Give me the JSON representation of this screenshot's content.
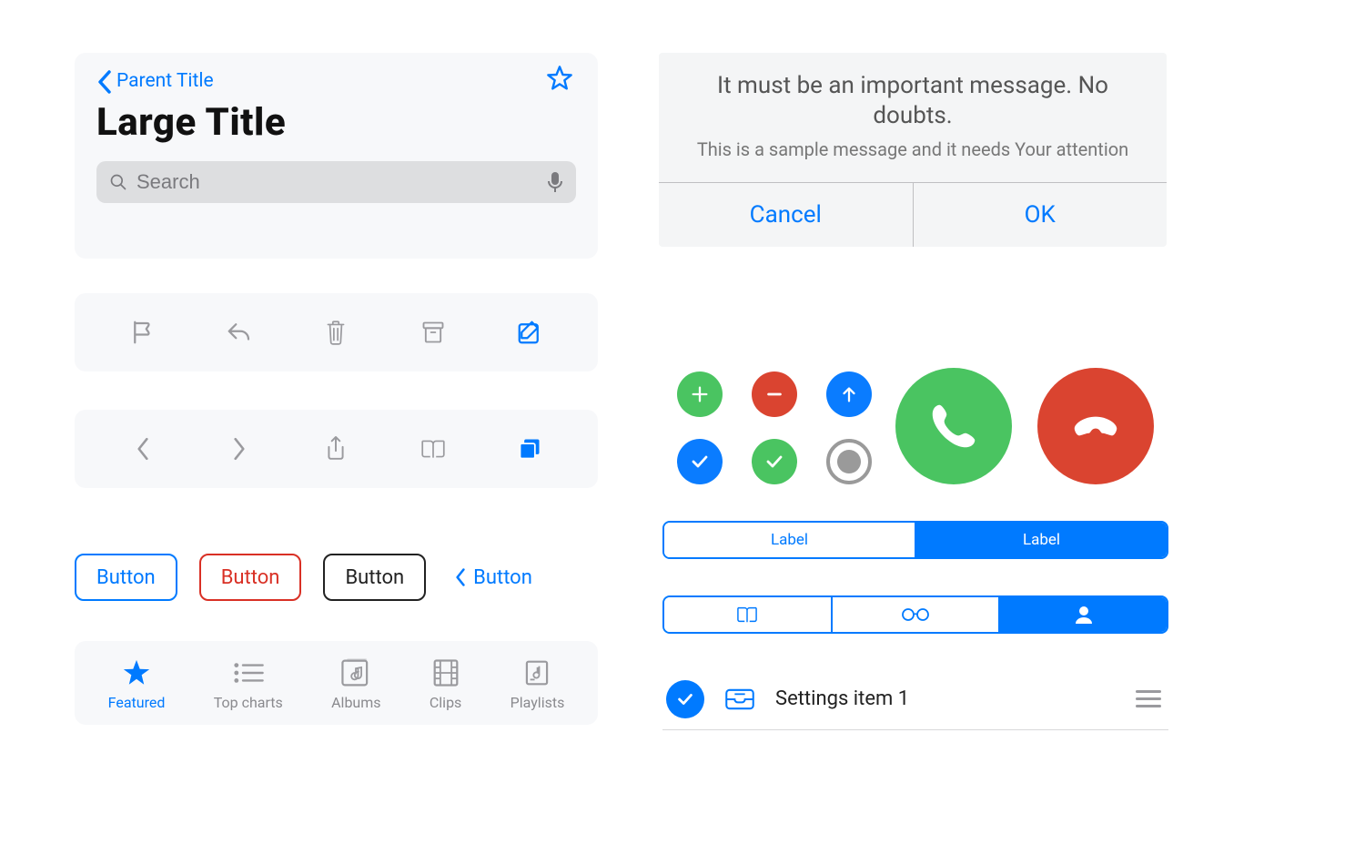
{
  "nav": {
    "back_label": "Parent Title",
    "title": "Large Title",
    "search_placeholder": "Search"
  },
  "buttons": {
    "blue": "Button",
    "red": "Button",
    "black": "Button",
    "back": "Button"
  },
  "tabs": {
    "featured": "Featured",
    "top_charts": "Top charts",
    "albums": "Albums",
    "clips": "Clips",
    "playlists": "Playlists"
  },
  "alert": {
    "title": "It must be an important message. No doubts.",
    "subtitle": "This is a sample message and it needs Your attention",
    "cancel": "Cancel",
    "ok": "OK"
  },
  "segmented1": {
    "a": "Label",
    "b": "Label"
  },
  "list": {
    "item1": "Settings item 1"
  },
  "colors": {
    "accent": "#007aff",
    "green": "#4ac461",
    "red": "#da4430"
  }
}
